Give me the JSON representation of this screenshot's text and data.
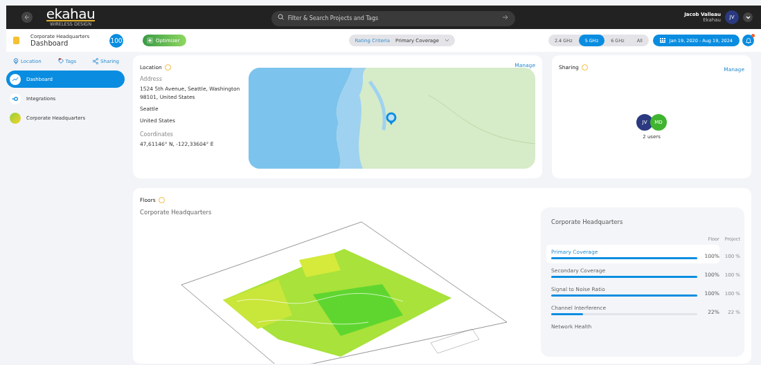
{
  "header": {
    "logo": "ekahau",
    "logo_tagline": "WIRELESS DESIGN",
    "search": {
      "placeholder": "Filter & Search Projects and Tags"
    },
    "user": {
      "name": "Jacob Valleau",
      "org": "Ekahau",
      "initials": "JV"
    }
  },
  "toolbar": {
    "project": "Corporate Headquarters",
    "page": "Dashboard",
    "score": "100",
    "optimizer": "Optimizer",
    "rating_label": "Rating Criteria",
    "rating_value": "Primary Coverage",
    "bands": [
      {
        "label": "2.4 GHz",
        "selected": false
      },
      {
        "label": "5 GHz",
        "selected": true
      },
      {
        "label": "6 GHz",
        "selected": false
      },
      {
        "label": "All",
        "selected": false
      }
    ],
    "date_range": "Jan 19, 2020 - Aug 19, 2024",
    "notification": true
  },
  "sidebar": {
    "links": [
      {
        "kind": "location",
        "label": "Location"
      },
      {
        "kind": "tags",
        "label": "Tags"
      },
      {
        "kind": "sharing",
        "label": "Sharing"
      }
    ],
    "items": [
      {
        "kind": "dashboard",
        "label": "Dashboard",
        "selected": true
      },
      {
        "kind": "integrations",
        "label": "Integrations",
        "selected": false
      },
      {
        "kind": "floor",
        "label": "Corporate Headquarters",
        "selected": false
      }
    ]
  },
  "location": {
    "title": "Location",
    "manage": "Manage",
    "address_label": "Address",
    "address": "1524 5th Avenue, Seattle, Washington 98101, United States",
    "city": "Seattle",
    "country": "United States",
    "coordinates_label": "Coordinates",
    "coordinates": "47,61146° N, -122,33604° E"
  },
  "sharing": {
    "title": "Sharing",
    "manage": "Manage",
    "avatars": [
      {
        "initials": "JV",
        "color": "#2b3a80"
      },
      {
        "initials": "MD",
        "color": "#3fb52f"
      }
    ],
    "count": "2 users"
  },
  "floors": {
    "title": "Floors",
    "floor_name": "Corporate Headquarters",
    "summary": {
      "title": "Corporate Headquarters",
      "col_floor": "Floor",
      "col_project": "Project",
      "metrics": [
        {
          "name": "Primary Coverage",
          "selected": true,
          "level": 1,
          "floor": "100%",
          "project": "100 %"
        },
        {
          "name": "Secondary Coverage",
          "selected": false,
          "level": 1,
          "floor": "100%",
          "project": "100 %"
        },
        {
          "name": "Signal to Noise Ratio",
          "selected": false,
          "level": 1,
          "floor": "100%",
          "project": "100 %"
        },
        {
          "name": "Channel Interference",
          "selected": false,
          "level": 0.22,
          "floor": "22%",
          "project": "22 %"
        },
        {
          "name": "Network Health",
          "selected": false
        }
      ]
    }
  }
}
